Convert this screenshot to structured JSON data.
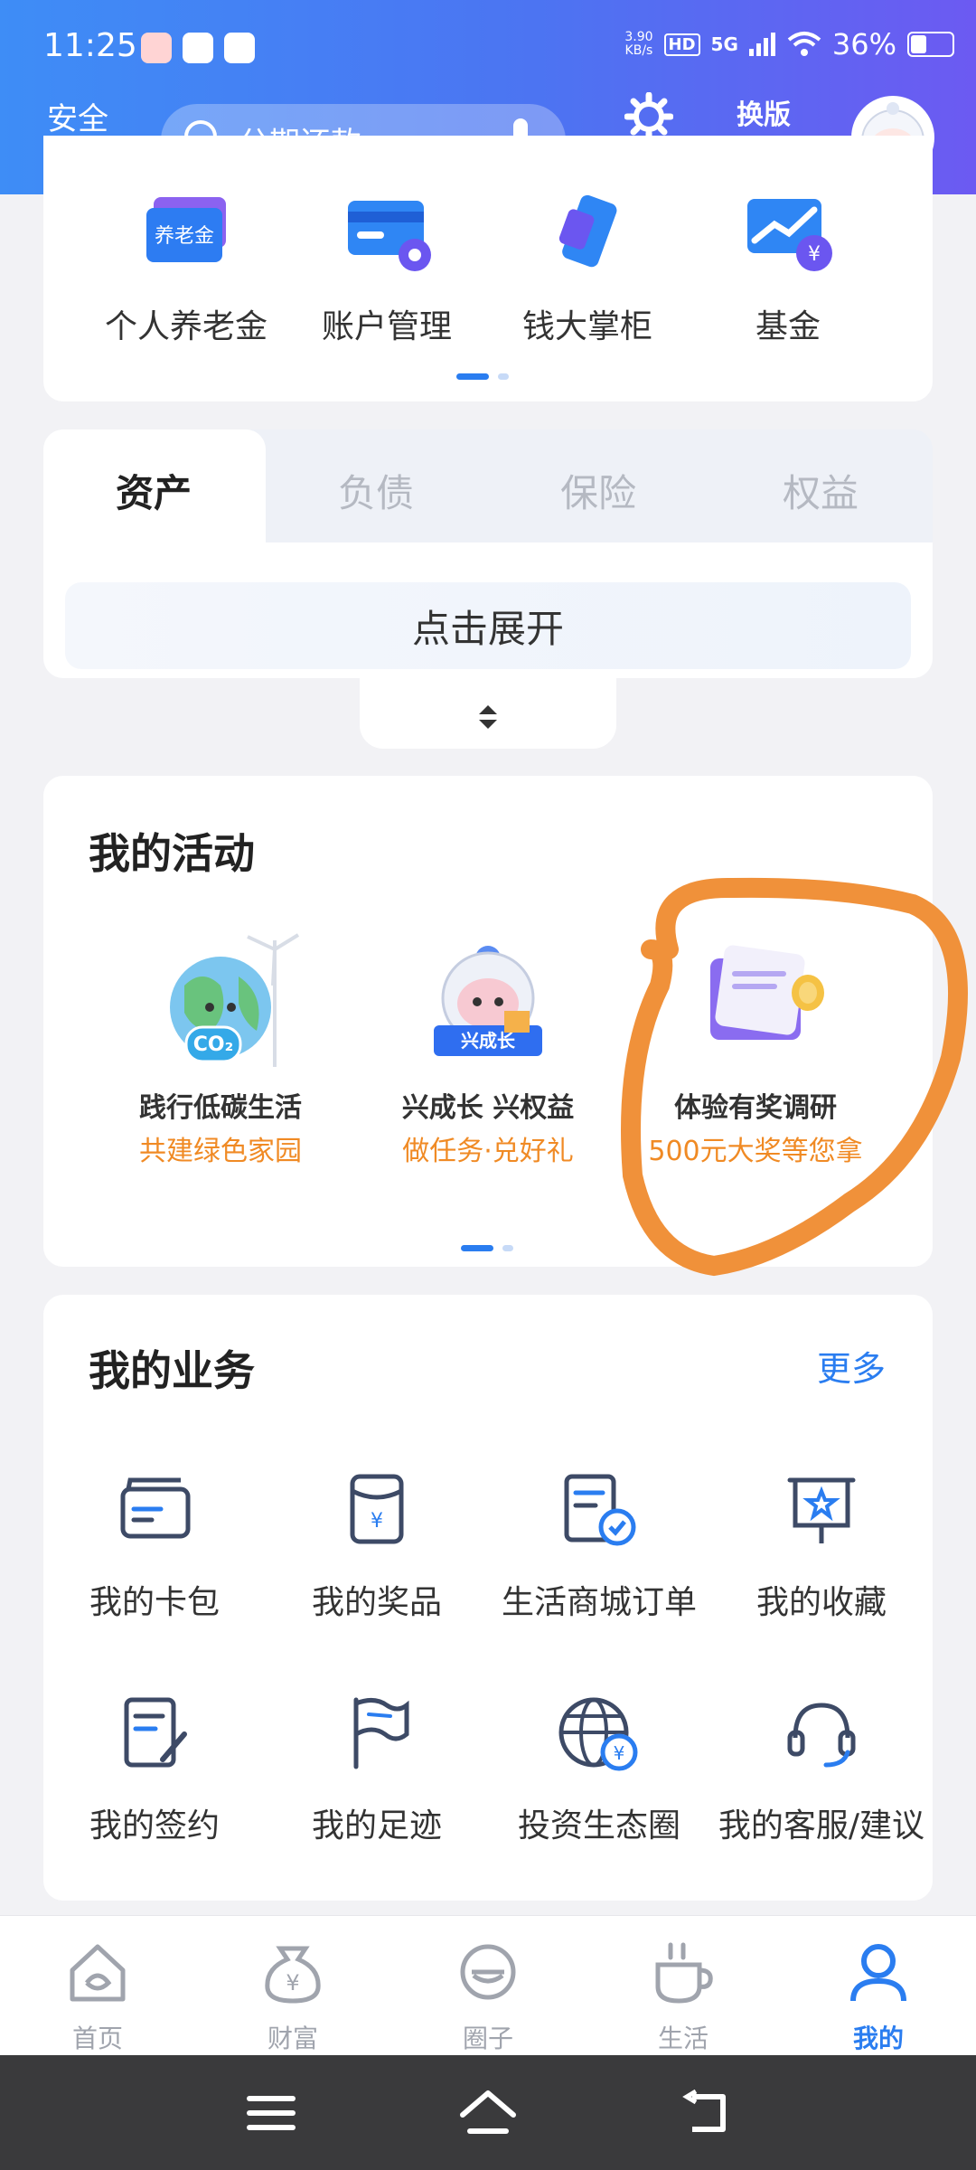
{
  "status": {
    "time": "11:25",
    "speed": "3.90",
    "speed_unit": "KB/s",
    "hd": "HD",
    "network": "5G",
    "battery": "36%",
    "battery_level": 0.36
  },
  "header": {
    "logout": "安全退出",
    "search_placeholder": "分期还款",
    "settings": "设置",
    "switch_label": "换版"
  },
  "quick_menu": [
    {
      "label": "个人养老金",
      "badge": "养老金"
    },
    {
      "label": "账户管理"
    },
    {
      "label": "钱大掌柜"
    },
    {
      "label": "基金"
    }
  ],
  "asset_tabs": [
    "资产",
    "负债",
    "保险",
    "权益"
  ],
  "expand_text": "点击展开",
  "activities": {
    "title": "我的活动",
    "items": [
      {
        "title": "践行低碳生活",
        "subtitle": "共建绿色家园",
        "badge": "CO₂"
      },
      {
        "title": "兴成长 兴权益",
        "subtitle": "做任务·兑好礼",
        "badge": "兴成长"
      },
      {
        "title": "体验有奖调研",
        "subtitle": "500元大奖等您拿"
      }
    ]
  },
  "business": {
    "title": "我的业务",
    "more": "更多",
    "items": [
      {
        "label": "我的卡包",
        "icon": "card-wallet-icon"
      },
      {
        "label": "我的奖品",
        "icon": "prize-icon"
      },
      {
        "label": "生活商城订单",
        "icon": "order-icon"
      },
      {
        "label": "我的收藏",
        "icon": "favorites-icon"
      },
      {
        "label": "我的签约",
        "icon": "sign-icon"
      },
      {
        "label": "我的足迹",
        "icon": "flag-icon"
      },
      {
        "label": "投资生态圈",
        "icon": "globe-icon"
      },
      {
        "label": "我的客服/建议",
        "icon": "headset-icon"
      }
    ]
  },
  "bottom_nav": [
    {
      "label": "首页",
      "active": false
    },
    {
      "label": "财富",
      "active": false
    },
    {
      "label": "圈子",
      "active": false
    },
    {
      "label": "生活",
      "active": false
    },
    {
      "label": "我的",
      "active": true
    }
  ],
  "colors": {
    "accent": "#2a7df0",
    "highlight": "#f08a24",
    "annotation": "#f0913a"
  }
}
